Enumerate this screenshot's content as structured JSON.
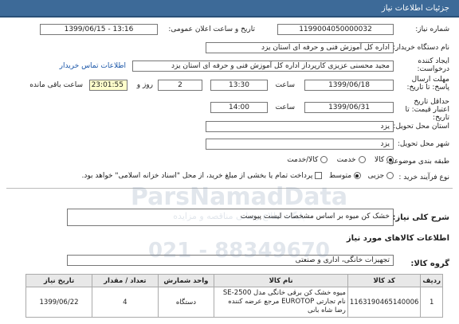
{
  "header": {
    "title": "جزئیات اطلاعات نیاز"
  },
  "need_number": {
    "label": "شماره نیاز:",
    "value": "1199004050000032"
  },
  "announce": {
    "label": "تاریخ و ساعت اعلان عمومی:",
    "value": "1399/06/15 - 13:16"
  },
  "buyer": {
    "label": "نام دستگاه خریدار:",
    "value": "اداره کل آموزش فنی و حرفه ای استان یزد"
  },
  "creator": {
    "label": "ایجاد کننده درخواست:",
    "value": "مجید محسنی عزیزی کارپرداز اداره کل آموزش فنی و حرفه ای استان یزد",
    "contact_link": "اطلاعات تماس خریدار"
  },
  "deadline": {
    "label": "مهلت ارسال پاسخ: تا تاریخ:",
    "date": "1399/06/18",
    "time_label": "ساعت",
    "time": "13:30",
    "days": "2",
    "days_label": "روز و",
    "remaining": "23:01:55",
    "remaining_label": "ساعت باقی مانده"
  },
  "validity": {
    "label": "حداقل تاریخ اعتبار قیمت: تا تاریخ:",
    "date": "1399/06/31",
    "time_label": "ساعت",
    "time": "14:00"
  },
  "province": {
    "label": "استان محل تحویل:",
    "value": "یزد"
  },
  "city": {
    "label": "شهر محل تحویل:",
    "value": "یزد"
  },
  "category": {
    "label": "طبقه بندی موضوعی:",
    "options": [
      "کالا",
      "خدمت",
      "کالا/خدمت"
    ],
    "selected": 0
  },
  "purchase_type": {
    "label": "نوع فرآیند خرید :",
    "options": [
      "جزیی",
      "متوسط"
    ],
    "selected": 1,
    "payment_note": "پرداخت تمام یا بخشی از مبلغ خرید، از محل \"اسناد خزانه اسلامی\" خواهد بود."
  },
  "summary": {
    "label": "شرح کلی نیاز:",
    "value": "خشک کن میوه بر اساس مشخصات لیست پیوست"
  },
  "goods_section": {
    "title": "اطلاعات کالاهای مورد نیاز"
  },
  "goods_group": {
    "label": "گروه کالا:",
    "value": "تجهیزات خانگی، اداری و صنعتی"
  },
  "table": {
    "headers": [
      "ردیف",
      "کد کالا",
      "نام کالا",
      "واحد شمارش",
      "تعداد / مقدار",
      "تاریخ نیاز"
    ],
    "rows": [
      {
        "row": "1",
        "code": "1163190465140006",
        "name": "میوه خشک کن برقی خانگی مدل SE-2500 نام تجارتی EUROTOP مرجع عرضه کننده رضا شاه بانی",
        "unit": "دستگاه",
        "qty": "4",
        "date": "1399/06/22"
      }
    ]
  },
  "watermark": {
    "brand": "ParsNamadData",
    "tagline": "پایگاه اطلاع رسانی مناقصه و مزایده",
    "phone": "021 - 88349670"
  }
}
